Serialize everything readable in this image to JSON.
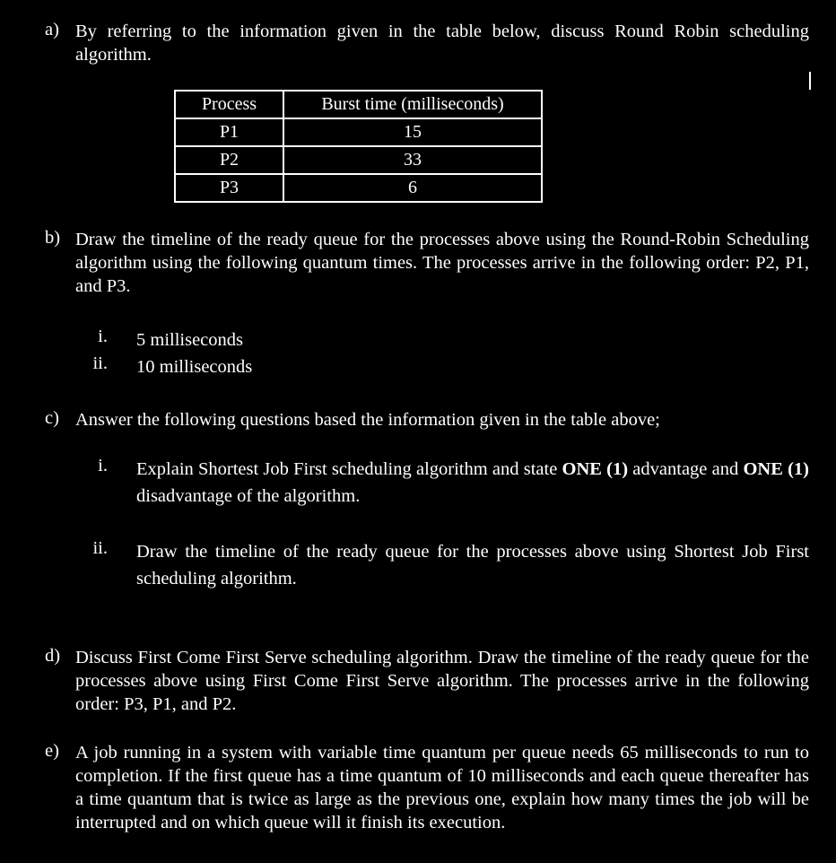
{
  "questions": {
    "a": {
      "label": "a)",
      "text": "By referring to the information given in the table below, discuss Round Robin scheduling algorithm."
    },
    "table": {
      "headers": [
        "Process",
        "Burst time (milliseconds)"
      ],
      "rows": [
        [
          "P1",
          "15"
        ],
        [
          "P2",
          "33"
        ],
        [
          "P3",
          "6"
        ]
      ]
    },
    "b": {
      "label": "b)",
      "text": "Draw the timeline of the ready queue for the processes above using the Round-Robin Scheduling algorithm using the following quantum times. The processes arrive in the following order: P2, P1, and P3.",
      "items": [
        {
          "num": "i.",
          "text": "5 milliseconds"
        },
        {
          "num": "ii.",
          "text": "10 milliseconds"
        }
      ]
    },
    "c": {
      "label": "c)",
      "text": "Answer the following questions based the information given in the table above;",
      "items": [
        {
          "num": "i.",
          "text_1": "Explain Shortest Job First scheduling algorithm and state ",
          "bold_1": "ONE (1)",
          "text_2": " advantage and ",
          "bold_2": "ONE (1)",
          "text_3": " disadvantage of the algorithm."
        },
        {
          "num": "ii.",
          "text": "Draw the timeline of the ready queue for the processes above using Shortest Job First scheduling algorithm."
        }
      ]
    },
    "d": {
      "label": "d)",
      "text": "Discuss First Come First Serve scheduling algorithm. Draw the timeline of the ready queue for the processes above using First Come First Serve algorithm. The processes arrive in the following order: P3, P1, and P2."
    },
    "e": {
      "label": "e)",
      "text": "A job running in a system with variable time quantum per queue needs 65 milliseconds to run to completion. If the first queue has a time quantum of 10 milliseconds and each queue thereafter has a time quantum that is twice as large as the previous one, explain how many times the job will be interrupted and on which queue will it finish its execution."
    }
  }
}
